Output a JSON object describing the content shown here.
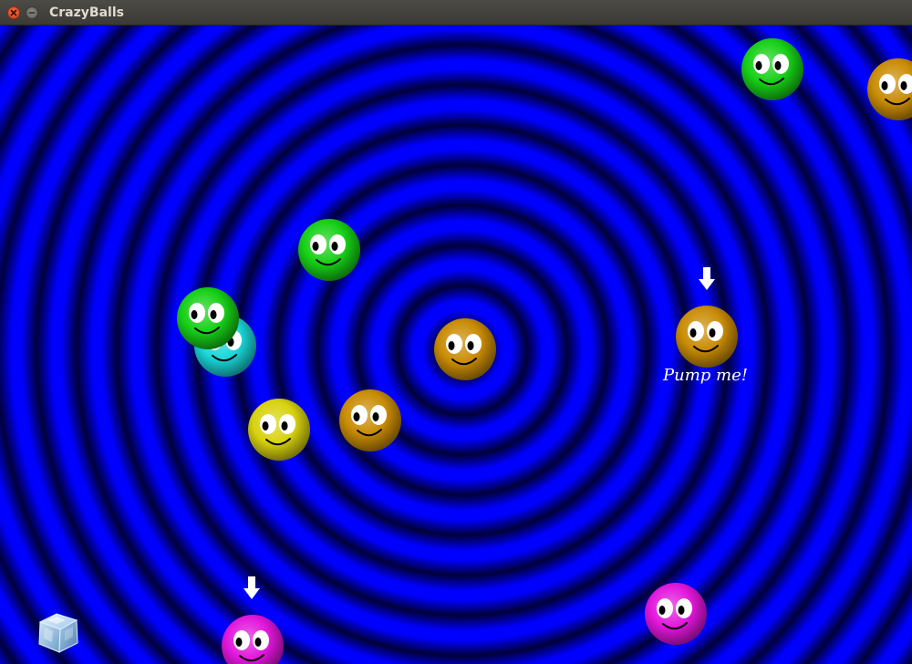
{
  "window": {
    "title": "CrazyBalls"
  },
  "hints": {
    "pump_label": "Pump me!"
  },
  "colors": {
    "green": "#17d017",
    "cyan": "#1ad6d8",
    "yellow": "#d8d20e",
    "orange": "#c98c04",
    "magenta": "#e216dc",
    "background_light": "#0000ff",
    "background_dark": "#00003a"
  },
  "balls": [
    {
      "color": "green"
    },
    {
      "color": "orange"
    },
    {
      "color": "green"
    },
    {
      "color": "cyan"
    },
    {
      "color": "green"
    },
    {
      "color": "orange"
    },
    {
      "color": "orange"
    },
    {
      "color": "yellow"
    },
    {
      "color": "orange"
    },
    {
      "color": "magenta"
    },
    {
      "color": "magenta"
    }
  ],
  "icons": {
    "pump_arrow": "down-arrow-icon",
    "freeze_powerup": "ice-cube-icon"
  }
}
